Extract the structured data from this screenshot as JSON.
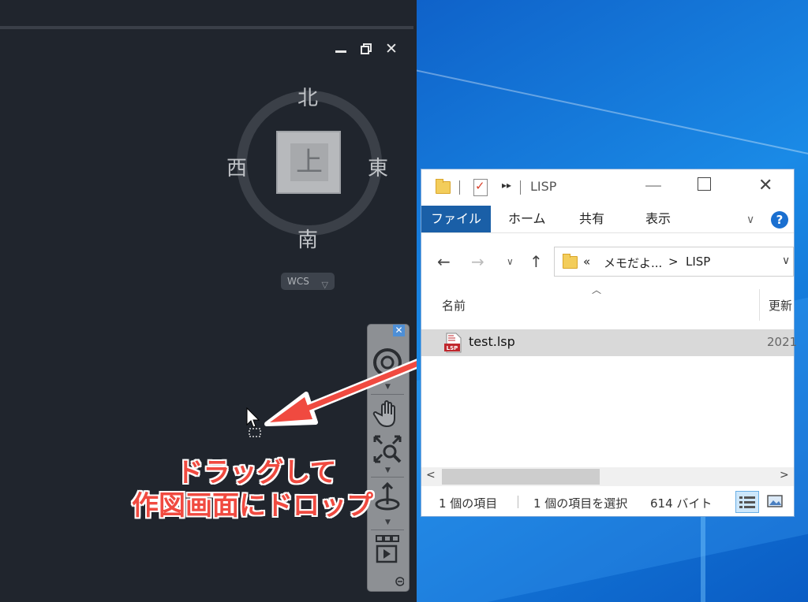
{
  "viewcube": {
    "north": "北",
    "south": "南",
    "west": "西",
    "east": "東",
    "face": "上",
    "coord_system": "WCS"
  },
  "navbar": {
    "tools": [
      "steering-wheel-icon",
      "pan-hand-icon",
      "zoom-extents-icon",
      "orbit-icon",
      "showmotion-icon"
    ]
  },
  "annotation": {
    "line1": "ドラッグして",
    "line2": "作図画面にドロップ",
    "color": "#f04a40"
  },
  "explorer": {
    "title": "LISP",
    "tabs": {
      "file": "ファイル",
      "home": "ホーム",
      "share": "共有",
      "view": "表示"
    },
    "help": "?",
    "address": {
      "prefix": "«",
      "parent": "メモだよ...",
      "separator": ">",
      "current": "LISP"
    },
    "columns": {
      "name": "名前",
      "date": "更新"
    },
    "files": [
      {
        "name": "test.lsp",
        "icon_label": "LSP",
        "date": "2021"
      }
    ],
    "status": {
      "count": "1 個の項目",
      "selected": "1 個の項目を選択",
      "size": "614 バイト"
    },
    "accent": "#1a5fa7"
  }
}
